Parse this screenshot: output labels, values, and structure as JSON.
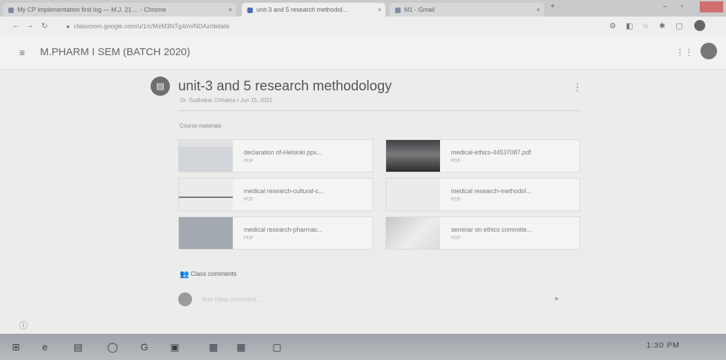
{
  "browser": {
    "tabs": [
      {
        "title": "My CP implementation first log — M.J. 21 ... - Chrome",
        "close": "×"
      },
      {
        "title": "unit-3 and 5 research methodol...",
        "close": "×"
      },
      {
        "title": "M1 - Gmail",
        "close": "×"
      }
    ],
    "new_tab": "+",
    "url": "classroom.google.com/u/1/c/MzM3NTg4/m/NDAz/details"
  },
  "app": {
    "class_title": "M.PHARM I SEM (BATCH 2020)"
  },
  "post": {
    "title": "unit-3 and 5 research methodology",
    "meta": "Dr. Sudhakar Chhabra • Jun 15, 2021",
    "menu_glyph": "⋮",
    "icon_glyph": "▤"
  },
  "materials": {
    "label": "Course materials",
    "items": [
      {
        "name": "declaration of-Helsinki ppx...",
        "type": "PDF"
      },
      {
        "name": "medical-ethics-44537087.pdf",
        "type": "PDF"
      },
      {
        "name": "medical research-cultural-c...",
        "type": "PDF"
      },
      {
        "name": "medical research-methodol...",
        "type": "PDF"
      },
      {
        "name": "medical research-pharmac...",
        "type": "PDF"
      },
      {
        "name": "seminar on ethics committe...",
        "type": "PDF"
      }
    ]
  },
  "comments": {
    "label": "Class comments",
    "placeholder": "Add class comment..."
  },
  "taskbar": {
    "clock": "1:30 PM"
  }
}
